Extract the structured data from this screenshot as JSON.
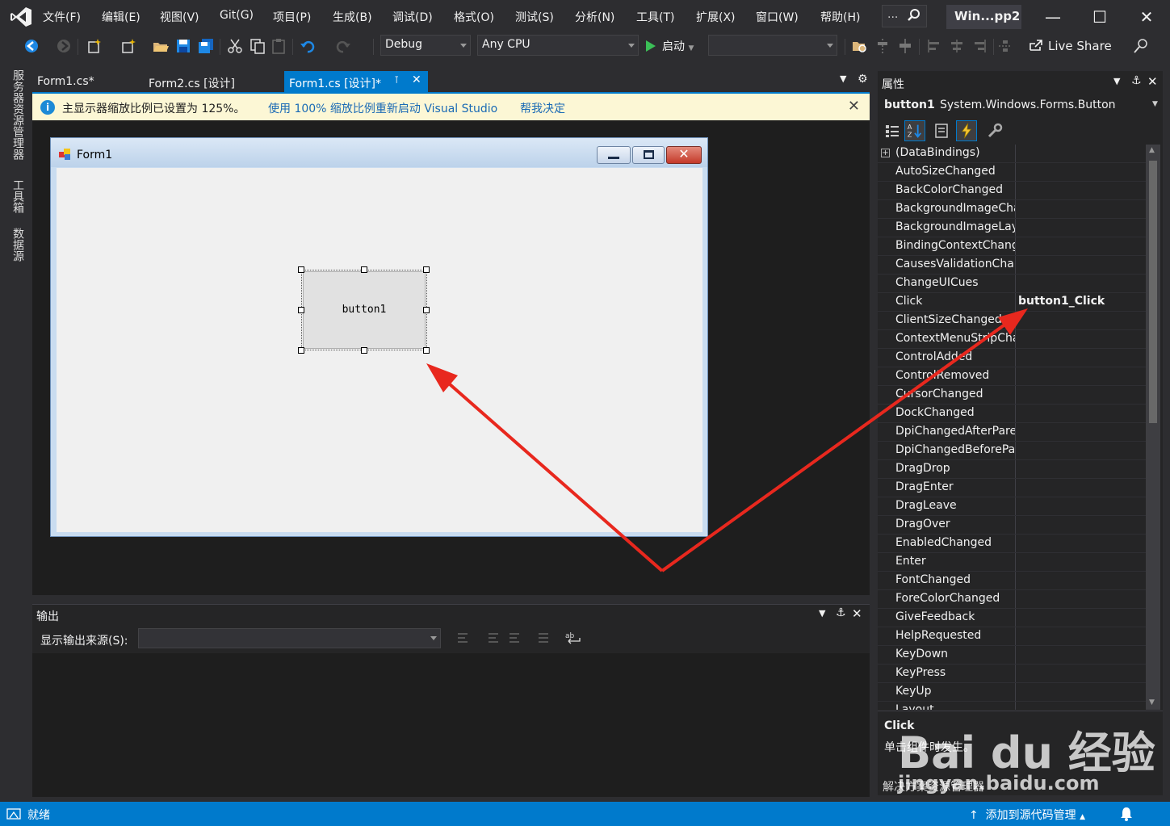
{
  "menubar": {
    "items": [
      "文件(F)",
      "编辑(E)",
      "视图(V)",
      "Git(G)",
      "项目(P)",
      "生成(B)",
      "调试(D)",
      "格式(O)",
      "测试(S)",
      "分析(N)",
      "工具(T)",
      "扩展(X)",
      "窗口(W)",
      "帮助(H)"
    ],
    "search_dots": "...",
    "window_title": "Win...pp2"
  },
  "toolbar": {
    "config": "Debug",
    "platform": "Any CPU",
    "start_label": "启动",
    "live_share": "Live Share"
  },
  "side_tabs": [
    "服务器资源管理器",
    "工具箱",
    "数据源"
  ],
  "doc_tabs": [
    {
      "label": "Form1.cs*"
    },
    {
      "label": "Form2.cs [设计]"
    },
    {
      "label": "Form1.cs [设计]*"
    }
  ],
  "infobar": {
    "message": "主显示器缩放比例已设置为 125%。",
    "link1": "使用 100% 缩放比例重新启动 Visual Studio",
    "link2": "帮我决定"
  },
  "form": {
    "title": "Form1",
    "button_text": "button1"
  },
  "output": {
    "title": "输出",
    "source_label": "显示输出来源(S):"
  },
  "properties": {
    "title": "属性",
    "object_name": "button1",
    "object_type": "System.Windows.Forms.Button",
    "rows": [
      {
        "name": "(DataBindings)",
        "value": ""
      },
      {
        "name": "AutoSizeChanged",
        "value": ""
      },
      {
        "name": "BackColorChanged",
        "value": ""
      },
      {
        "name": "BackgroundImageChanged",
        "value": ""
      },
      {
        "name": "BackgroundImageLayoutChanged",
        "value": ""
      },
      {
        "name": "BindingContextChanged",
        "value": ""
      },
      {
        "name": "CausesValidationChanged",
        "value": ""
      },
      {
        "name": "ChangeUICues",
        "value": ""
      },
      {
        "name": "Click",
        "value": "button1_Click"
      },
      {
        "name": "ClientSizeChanged",
        "value": ""
      },
      {
        "name": "ContextMenuStripChanged",
        "value": ""
      },
      {
        "name": "ControlAdded",
        "value": ""
      },
      {
        "name": "ControlRemoved",
        "value": ""
      },
      {
        "name": "CursorChanged",
        "value": ""
      },
      {
        "name": "DockChanged",
        "value": ""
      },
      {
        "name": "DpiChangedAfterParent",
        "value": ""
      },
      {
        "name": "DpiChangedBeforeParent",
        "value": ""
      },
      {
        "name": "DragDrop",
        "value": ""
      },
      {
        "name": "DragEnter",
        "value": ""
      },
      {
        "name": "DragLeave",
        "value": ""
      },
      {
        "name": "DragOver",
        "value": ""
      },
      {
        "name": "EnabledChanged",
        "value": ""
      },
      {
        "name": "Enter",
        "value": ""
      },
      {
        "name": "FontChanged",
        "value": ""
      },
      {
        "name": "ForeColorChanged",
        "value": ""
      },
      {
        "name": "GiveFeedback",
        "value": ""
      },
      {
        "name": "HelpRequested",
        "value": ""
      },
      {
        "name": "KeyDown",
        "value": ""
      },
      {
        "name": "KeyPress",
        "value": ""
      },
      {
        "name": "KeyUp",
        "value": ""
      },
      {
        "name": "Layout",
        "value": ""
      }
    ],
    "desc_title": "Click",
    "desc_text": "单击组件时发生。",
    "solution_tab": "解决方案资源管理器"
  },
  "statusbar": {
    "text": "就绪",
    "source_control": "添加到源代码管理"
  },
  "watermark": {
    "brand": "Bai du 经验",
    "url": "jingyan.baidu.com"
  },
  "colors": {
    "accent": "#007acc",
    "arrow": "#e8281e"
  }
}
